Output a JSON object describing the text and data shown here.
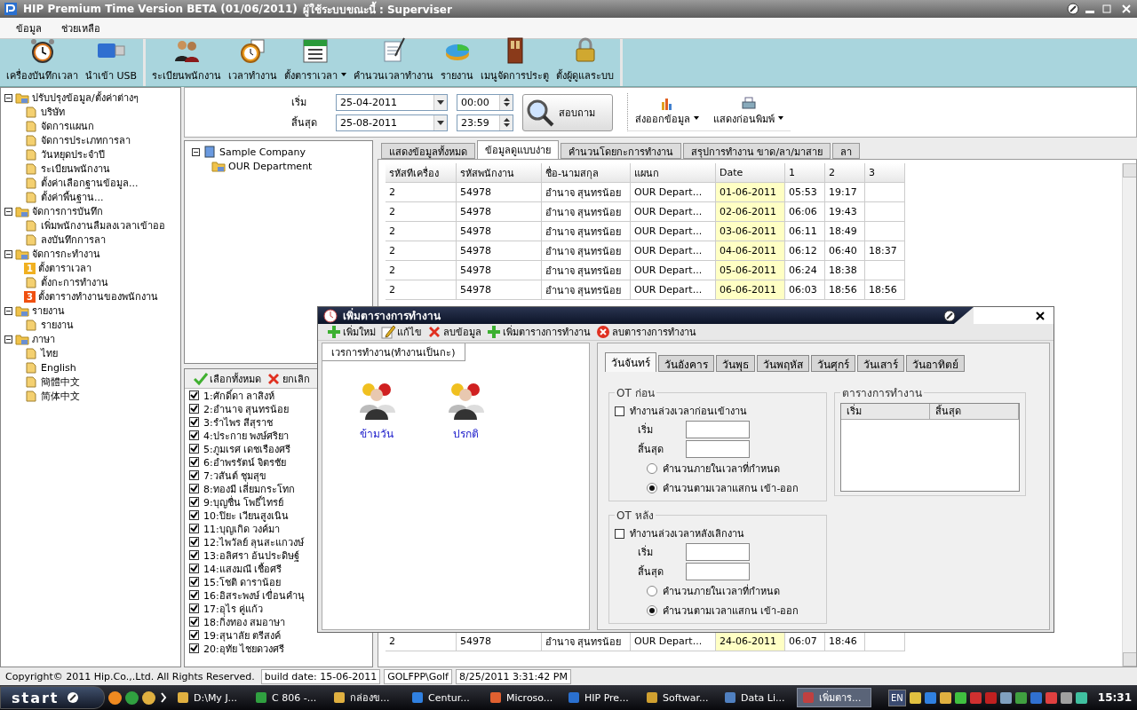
{
  "window": {
    "title": "HIP Premium Time Version BETA (01/06/2011)",
    "user": "ผู้ใช้ระบบขณะนี้ : Superviser"
  },
  "menu": [
    "ข้อมูล",
    "ช่วยเหลือ"
  ],
  "toolbar": {
    "groups": [
      [
        {
          "label": "เครื่องบันทึกเวลา",
          "dropdown": false
        },
        {
          "label": "นำเข้า USB",
          "dropdown": false
        }
      ],
      [
        {
          "label": "ระเบียนพนักงาน",
          "dropdown": false
        },
        {
          "label": "เวลาทำงาน",
          "dropdown": false
        },
        {
          "label": "ตั้งตาราเวลา",
          "dropdown": true
        },
        {
          "label": "คำนวนเวลาทำงาน",
          "dropdown": false
        },
        {
          "label": "รายงาน",
          "dropdown": false
        },
        {
          "label": "เมนูจัดการประตู",
          "dropdown": false
        },
        {
          "label": "ตั้งผู้ดูแลระบบ",
          "dropdown": false
        }
      ]
    ]
  },
  "nav_tree": [
    {
      "label": "ปรับปรุงข้อมูล/ตั้งค่าต่างๆ",
      "expanded": true,
      "children": [
        {
          "label": "บริษัท"
        },
        {
          "label": "จัดการแผนก"
        },
        {
          "label": "จัดการประเภทการลา"
        },
        {
          "label": "วันหยุดประจำปี"
        },
        {
          "label": "ระเบียนพนักงาน"
        },
        {
          "label": "ตั้งค่าเลือกฐานข้อมูล..."
        },
        {
          "label": "ตั้งค่าพื้นฐาน..."
        }
      ]
    },
    {
      "label": "จัดการการบันทึก",
      "expanded": true,
      "children": [
        {
          "label": "เพิ่มพนักงานลืมลงเวลาเข้าออ"
        },
        {
          "label": "ลงบันทึกการลา"
        }
      ]
    },
    {
      "label": "จัดการกะทำงาน",
      "expanded": true,
      "children": [
        {
          "label": "ตั้งตาราเวลา",
          "badge": "1"
        },
        {
          "label": "ตั้งกะการทำงาน"
        },
        {
          "label": "ตั้งตารางทำงานของพนักงาน",
          "badge": "3"
        }
      ]
    },
    {
      "label": "รายงาน",
      "expanded": true,
      "children": [
        {
          "label": "รายงาน"
        }
      ]
    },
    {
      "label": "ภาษา",
      "expanded": true,
      "children": [
        {
          "label": "ไทย"
        },
        {
          "label": "English"
        },
        {
          "label": "簡體中文"
        },
        {
          "label": "简体中文"
        }
      ]
    }
  ],
  "filter": {
    "start_label": "เริ่ม",
    "start_date": "25-04-2011",
    "start_time": "00:00",
    "end_label": "สิ้นสุด",
    "end_date": "25-08-2011",
    "end_time": "23:59",
    "search_button": "สอบถาม",
    "export_button": "ส่งออกข้อมูล",
    "preview_button": "แสดงก่อนพิมพ์"
  },
  "company_tree": {
    "label": "Sample Company",
    "expanded": true,
    "children": [
      {
        "label": "OUR Department"
      }
    ]
  },
  "employee_list": {
    "select_all": "เลือกทั้งหมด",
    "cancel": "ยกเลิก",
    "items": [
      {
        "label": "1:ศักดิ์ดา ลาสิงห์",
        "checked": true
      },
      {
        "label": "2:อำนาจ สุนทรน้อย",
        "checked": true
      },
      {
        "label": "3:รำไพร สีสุราช",
        "checked": true
      },
      {
        "label": "4:ประกาย พงษ์ศริยา",
        "checked": true
      },
      {
        "label": "5:ภูมเรศ เดชเรืองศรี",
        "checked": true
      },
      {
        "label": "6:อำพรรัตน์ จิตรชัย",
        "checked": true
      },
      {
        "label": "7:วสันต์ ชุมสุข",
        "checked": true
      },
      {
        "label": "8:ทองมี เลี่ยมกระโทก",
        "checked": true
      },
      {
        "label": "9:บุญชื่น โพธิ์ไทรย์",
        "checked": true
      },
      {
        "label": "10:ปิยะ เวียนสูงเนิน",
        "checked": true
      },
      {
        "label": "11:บุญเกิด วงค์มา",
        "checked": true
      },
      {
        "label": "12:ไพวัลย์ ลุนสะแกวงษ์",
        "checked": true
      },
      {
        "label": "13:อลิศรา อ้นประดิษฐ์",
        "checked": true
      },
      {
        "label": "14:แสงมณี เชื้อศรี",
        "checked": true
      },
      {
        "label": "15:โชติ ดาราน้อย",
        "checked": true
      },
      {
        "label": "16:อิสระพงษ์ เขื่อนคำนุ",
        "checked": true
      },
      {
        "label": "17:อุไร คู่แก้ว",
        "checked": true
      },
      {
        "label": "18:กิ่งทอง สมอาษา",
        "checked": true
      },
      {
        "label": "19:สุนาลัย ตรีสงค์",
        "checked": true
      },
      {
        "label": "20:อุทัย ไชยดวงศรี",
        "checked": true
      }
    ]
  },
  "tabs": [
    {
      "label": "แสดงข้อมูลทั้งหมด",
      "selected": false
    },
    {
      "label": "ข้อมูลดูแบบง่าย",
      "selected": true
    },
    {
      "label": "คำนวนโดยกะการทำงาน",
      "selected": false
    },
    {
      "label": "สรุปการทำงาน ขาด/ลา/มาสาย",
      "selected": false
    },
    {
      "label": "ลา",
      "selected": false
    }
  ],
  "table": {
    "columns": [
      {
        "label": "รหัสทีเครื่อง",
        "highlighted": false
      },
      {
        "label": "รหัสพนักงาน",
        "highlighted": false
      },
      {
        "label": "ชื่อ-นามสกุล",
        "highlighted": false
      },
      {
        "label": "แผนก",
        "highlighted": false
      },
      {
        "label": "Date",
        "highlighted": true
      },
      {
        "label": "1",
        "highlighted": false
      },
      {
        "label": "2",
        "highlighted": false
      },
      {
        "label": "3",
        "highlighted": false
      }
    ],
    "rows": [
      [
        "2",
        "54978",
        "อำนาจ สุนทรน้อย",
        "OUR Depart...",
        "01-06-2011",
        "05:53",
        "19:17",
        ""
      ],
      [
        "2",
        "54978",
        "อำนาจ สุนทรน้อย",
        "OUR Depart...",
        "02-06-2011",
        "06:06",
        "19:43",
        ""
      ],
      [
        "2",
        "54978",
        "อำนาจ สุนทรน้อย",
        "OUR Depart...",
        "03-06-2011",
        "06:11",
        "18:49",
        ""
      ],
      [
        "2",
        "54978",
        "อำนาจ สุนทรน้อย",
        "OUR Depart...",
        "04-06-2011",
        "06:12",
        "06:40",
        "18:37"
      ],
      [
        "2",
        "54978",
        "อำนาจ สุนทรน้อย",
        "OUR Depart...",
        "05-06-2011",
        "06:24",
        "18:38",
        ""
      ],
      [
        "2",
        "54978",
        "อำนาจ สุนทรน้อย",
        "OUR Depart...",
        "06-06-2011",
        "06:03",
        "18:56",
        "18:56"
      ]
    ],
    "lower_rows": [
      [
        "2",
        "54978",
        "อำนาจ สุนทรน้อย",
        "OUR Depart...",
        "24-06-2011",
        "06:07",
        "18:46",
        ""
      ]
    ]
  },
  "dialog": {
    "title": "เพิ่มตารางการทำงาน",
    "toolbar": [
      "เพิ่มใหม่",
      "แก้ไข",
      "ลบข้อมูล",
      "เพิ่มตารางการทำงาน",
      "ลบตารางการทำงาน"
    ],
    "shift_tab": "เวรการทำงาน(ทำงานเป็นกะ)",
    "shifts": [
      "ข้ามวัน",
      "ปรกติ"
    ],
    "day_tabs": [
      {
        "label": "วันจันทร์",
        "selected": true
      },
      {
        "label": "วันอังคาร",
        "selected": false
      },
      {
        "label": "วันพุธ",
        "selected": false
      },
      {
        "label": "วันพฤหัส",
        "selected": false
      },
      {
        "label": "วันศุกร์",
        "selected": false
      },
      {
        "label": "วันเสาร์",
        "selected": false
      },
      {
        "label": "วันอาทิตย์",
        "selected": false
      }
    ],
    "ot_groups": [
      {
        "title": "OT ก่อน",
        "checkbox": {
          "label": "ทำงานล่วงเวลาก่อนเข้างาน",
          "checked": false
        },
        "start_label": "เริ่ม",
        "end_label": "สิ้นสุด",
        "options": [
          {
            "label": "คำนวนภายในเวลาที่กำหนด",
            "selected": false
          },
          {
            "label": "คำนวนตามเวลาแสกน เข้า-ออก",
            "selected": true
          }
        ]
      },
      {
        "title": "OT หลัง",
        "checkbox": {
          "label": "ทำงานล่วงเวลาหลังเลิกงาน",
          "checked": false
        },
        "start_label": "เริ่ม",
        "end_label": "สิ้นสุด",
        "options": [
          {
            "label": "คำนวนภายในเวลาที่กำหนด",
            "selected": false
          },
          {
            "label": "คำนวนตามเวลาแสกน เข้า-ออก",
            "selected": true
          }
        ]
      }
    ],
    "schedule": {
      "title": "ตารางการทำงาน",
      "columns": [
        "เริ่ม",
        "สิ้นสุด"
      ]
    }
  },
  "status_bar": {
    "copyright": "Copyright© 2011 Hip.Co.,.Ltd. All Rights Reserved.",
    "build_date": "build date: 15-06-2011",
    "user": "GOLFPP\\Golf",
    "datetime": "8/25/2011 3:31:42 PM"
  },
  "taskbar": {
    "start": "start",
    "tasks": [
      {
        "label": "D:\\My J...",
        "selected": false
      },
      {
        "label": "C 806 -...",
        "selected": false
      },
      {
        "label": "กล่องข...",
        "selected": false
      },
      {
        "label": "Centur...",
        "selected": false
      },
      {
        "label": "Microso...",
        "selected": false
      },
      {
        "label": "HIP Pre...",
        "selected": false
      },
      {
        "label": "Softwar...",
        "selected": false
      },
      {
        "label": "Data Li...",
        "selected": false
      },
      {
        "label": "เพิ่มตาร...",
        "selected": true
      }
    ],
    "language": "EN",
    "clock": "15:31"
  }
}
